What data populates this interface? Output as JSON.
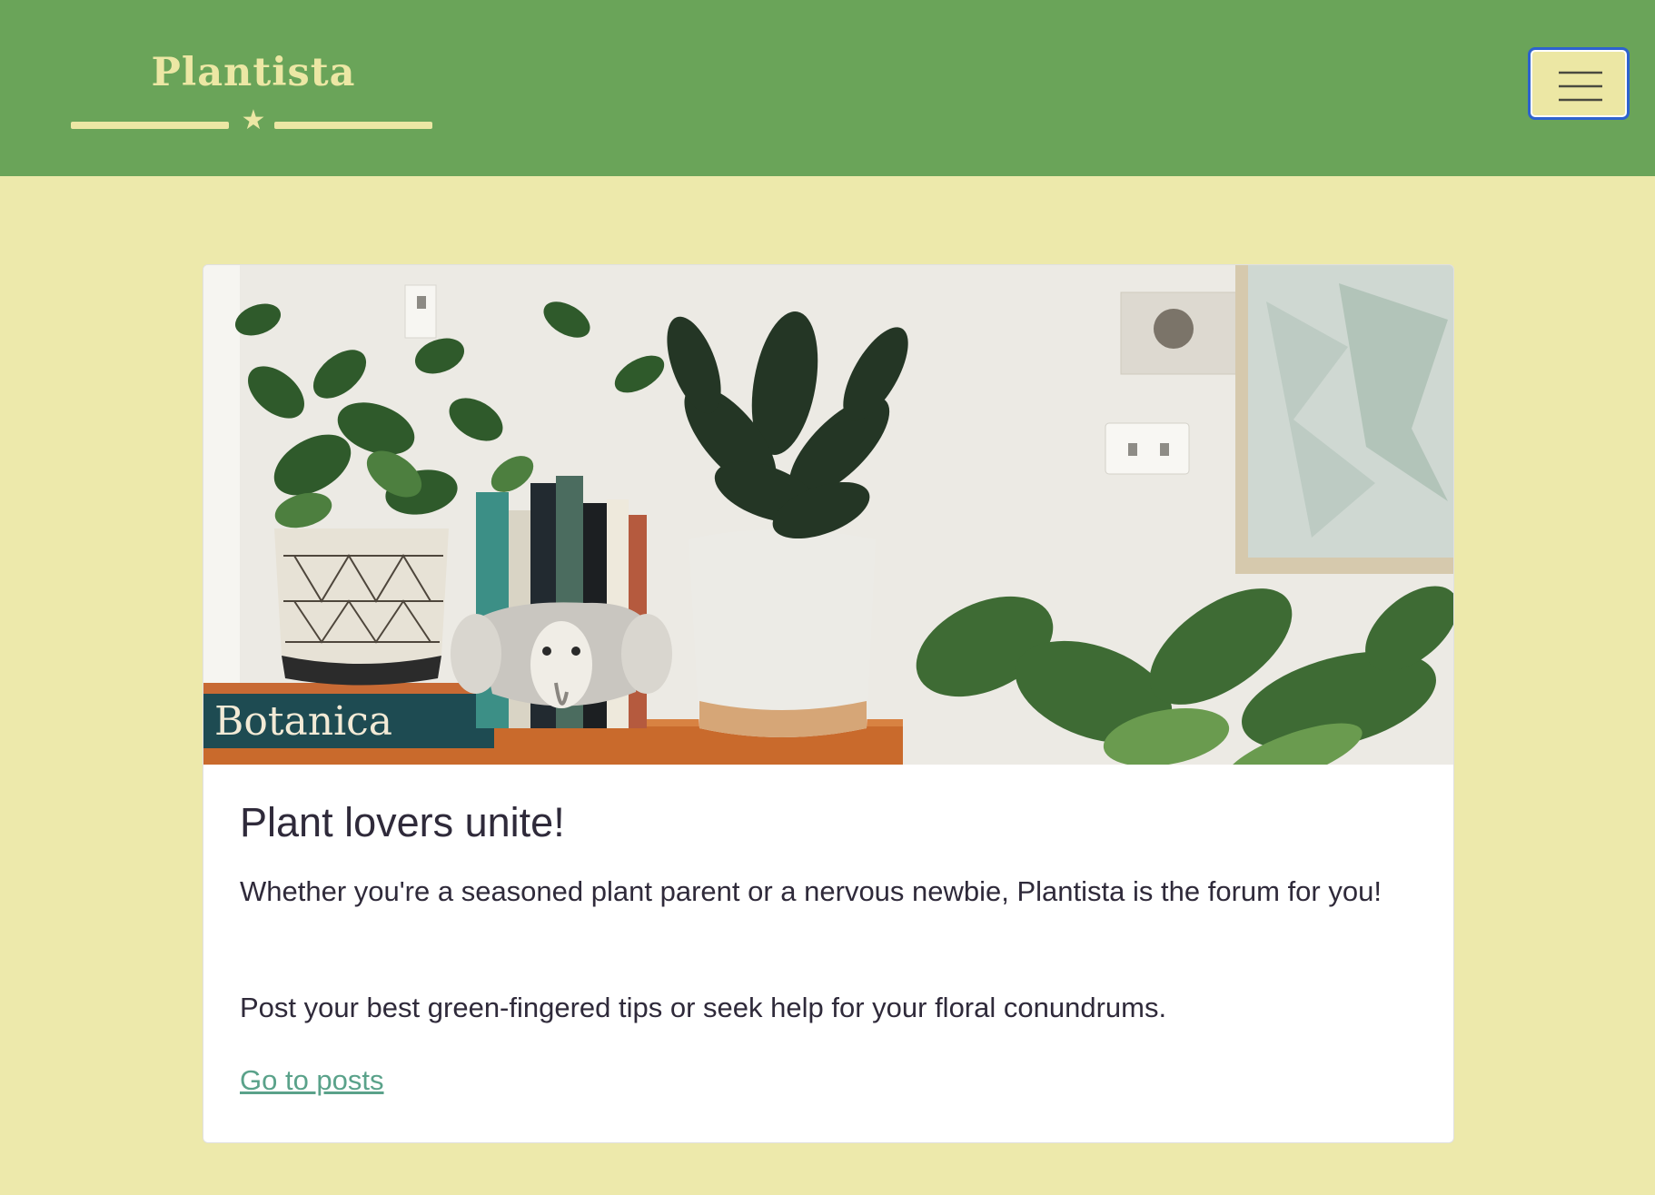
{
  "navbar": {
    "brand": "Plantista",
    "toggler_label": "Toggle navigation"
  },
  "card": {
    "image_alt": "Houseplants on a wooden shelf beside books",
    "book_spine_text": "Botanica",
    "title": "Plant lovers unite!",
    "paragraph_1": "Whether you're a seasoned plant parent or a nervous newbie, Plantista is the forum for you!",
    "paragraph_2": "Post your best green-fingered tips or seek help for your floral conundrums.",
    "link": "Go to posts"
  },
  "colors": {
    "page_bg": "#ede9ab",
    "navbar_bg": "#6aa459",
    "brand_cream": "#ece7a4",
    "link": "#5aa28a",
    "text": "#2f2a3a"
  }
}
